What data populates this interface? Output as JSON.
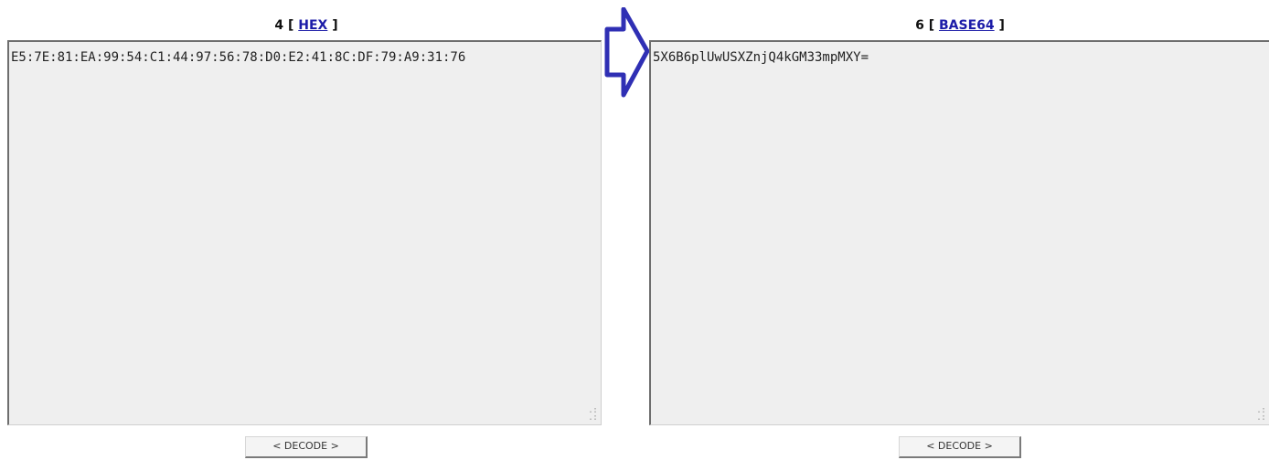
{
  "left_panel": {
    "prefix": "4 [ ",
    "link_label": "HEX",
    "suffix": " ]",
    "content": "E5:7E:81:EA:99:54:C1:44:97:56:78:D0:E2:41:8C:DF:79:A9:31:76",
    "decode_label": "< DECODE >"
  },
  "right_panel": {
    "prefix": "6 [ ",
    "link_label": "BASE64",
    "suffix": " ]",
    "content": "5X6B6plUwUSXZnjQ4kGM33mpMXY=",
    "decode_label": "< DECODE >"
  },
  "icons": {
    "arrow": "right-arrow-icon",
    "resize": "resize-grip-icon"
  },
  "colors": {
    "link": "#1c1ca8",
    "arrow": "#2f2fb4",
    "textbox_bg": "#efefef"
  }
}
